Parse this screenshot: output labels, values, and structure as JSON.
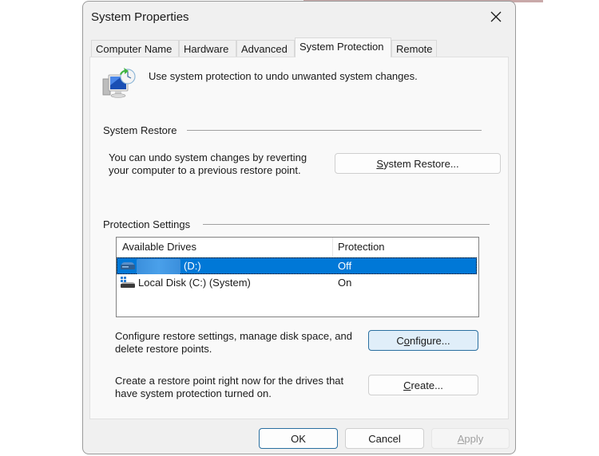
{
  "window": {
    "title": "System Properties",
    "close_icon": "close-x-icon"
  },
  "tabs": [
    {
      "label": "Computer Name",
      "active": false
    },
    {
      "label": "Hardware",
      "active": false
    },
    {
      "label": "Advanced",
      "active": false
    },
    {
      "label": "System Protection",
      "active": true
    },
    {
      "label": "Remote",
      "active": false
    }
  ],
  "intro": {
    "icon": "system-restore-icon",
    "text": "Use system protection to undo unwanted system changes."
  },
  "system_restore": {
    "heading": "System Restore",
    "description_line1": "You can undo system changes by reverting",
    "description_line2": "your computer to a previous restore point.",
    "button": {
      "mnemonic": "S",
      "rest": "ystem Restore..."
    }
  },
  "protection_settings": {
    "heading": "Protection Settings",
    "columns": [
      "Available Drives",
      "Protection"
    ],
    "drives": [
      {
        "name": "(D:)",
        "name_redacted": true,
        "protection": "Off",
        "selected": true,
        "icon": "drive-icon"
      },
      {
        "name": "Local Disk (C:) (System)",
        "name_redacted": false,
        "protection": "On",
        "selected": false,
        "icon": "system-drive-icon"
      }
    ],
    "configure": {
      "description_line1": "Configure restore settings, manage disk space, and",
      "description_line2": "delete restore points.",
      "button": {
        "pre": "C",
        "mnemonic": "o",
        "rest": "nfigure..."
      }
    },
    "create": {
      "description_line1": "Create a restore point right now for the drives that",
      "description_line2": "have system protection turned on.",
      "button": {
        "mnemonic": "C",
        "rest": "reate..."
      }
    }
  },
  "footer": {
    "ok": "OK",
    "cancel": "Cancel",
    "apply": {
      "mnemonic": "A",
      "rest": "pply",
      "disabled": true
    }
  },
  "colors": {
    "selection": "#0078d7",
    "focus_border": "#2a6fa0",
    "focus_fill": "#e0eef9"
  }
}
